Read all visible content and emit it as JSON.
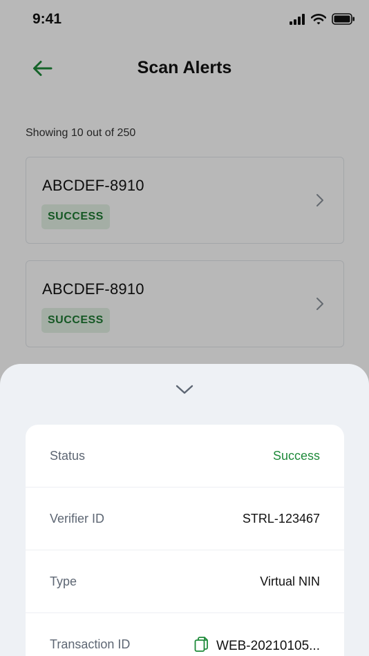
{
  "status_bar": {
    "time": "9:41"
  },
  "header": {
    "title": "Scan Alerts"
  },
  "list": {
    "count_text": "Showing 10 out of 250",
    "items": [
      {
        "id": "ABCDEF-8910",
        "status": "SUCCESS"
      },
      {
        "id": "ABCDEF-8910",
        "status": "SUCCESS"
      }
    ]
  },
  "sheet": {
    "rows": [
      {
        "label": "Status",
        "value": "Success"
      },
      {
        "label": "Verifier ID",
        "value": "STRL-123467"
      },
      {
        "label": "Type",
        "value": "Virtual NIN"
      },
      {
        "label": "Transaction ID",
        "value": "WEB-20210105..."
      }
    ]
  },
  "colors": {
    "accent": "#1e8a3a",
    "badge_bg": "#e3f1e5",
    "sheet_bg": "#eef1f5",
    "scrim": "rgba(0,0,0,0.28)"
  },
  "icons": {
    "back": "arrow-left-icon",
    "collapse": "chevron-down-icon",
    "row_chevron": "chevron-right-icon",
    "copy": "copy-icon",
    "signal": "signal-icon",
    "wifi": "wifi-icon",
    "battery": "battery-icon"
  }
}
